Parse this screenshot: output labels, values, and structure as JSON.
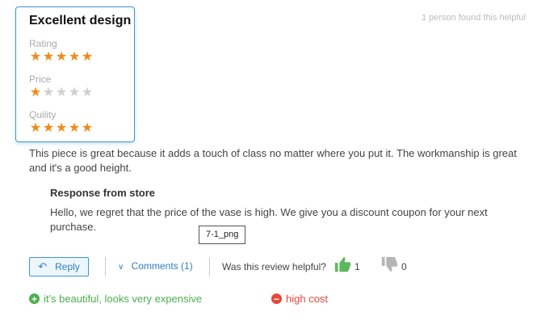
{
  "review": {
    "title": "Excellent design",
    "ratings": [
      {
        "label": "Rating",
        "stars": 5,
        "max": 5
      },
      {
        "label": "Price",
        "stars": 1,
        "max": 5
      },
      {
        "label": "Quility",
        "stars": 5,
        "max": 5
      }
    ],
    "helpful_summary": "1 person found this helpful",
    "text": "This piece is great because it adds a touch of class no matter where you put it. The workmanship is great and it's a good height."
  },
  "response": {
    "title": "Response from store",
    "text": "Hello, we regret that the price of the vase is high. We give you a discount coupon for your next purchase."
  },
  "tooltip": "7-1_png",
  "actions": {
    "reply_label": "Reply",
    "comments_label": "Comments (1)",
    "helpful_question": "Was this review helpful?",
    "up_count": "1",
    "down_count": "0"
  },
  "pros_cons": {
    "pro": "it's beautiful, looks very expensive",
    "con": "high cost"
  },
  "colors": {
    "accent": "#3a97d4",
    "star": "#ef8a1a",
    "thumb_up": "#5cb85c",
    "thumb_down": "#b5b5b5",
    "pro": "#4caf50",
    "con": "#e4473b"
  }
}
